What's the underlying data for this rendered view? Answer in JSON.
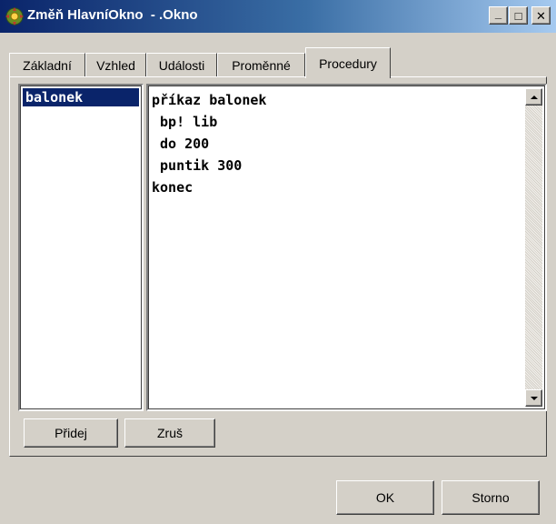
{
  "window": {
    "title": "Změň HlavníOkno  - .Okno",
    "icon": "app-gear-icon",
    "controls": {
      "minimize": "_",
      "maximize": "□",
      "close": "✕"
    }
  },
  "tabs": [
    {
      "label": "Základní",
      "active": false
    },
    {
      "label": "Vzhled",
      "active": false
    },
    {
      "label": "Události",
      "active": false
    },
    {
      "label": "Proměnné",
      "active": false
    },
    {
      "label": "Procedury",
      "active": true
    }
  ],
  "procedures": {
    "items": [
      "balonek"
    ],
    "selected": "balonek"
  },
  "code": {
    "text": "příkaz balonek\n bp! lib\n do 200\n puntik 300\nkonec"
  },
  "buttons": {
    "add": "Přidej",
    "delete": "Zruš",
    "ok": "OK",
    "cancel": "Storno"
  },
  "colors": {
    "face": "#d4d0c8",
    "selection": "#0a246a",
    "titlebar_start": "#0a246a",
    "titlebar_end": "#a6caf0"
  }
}
